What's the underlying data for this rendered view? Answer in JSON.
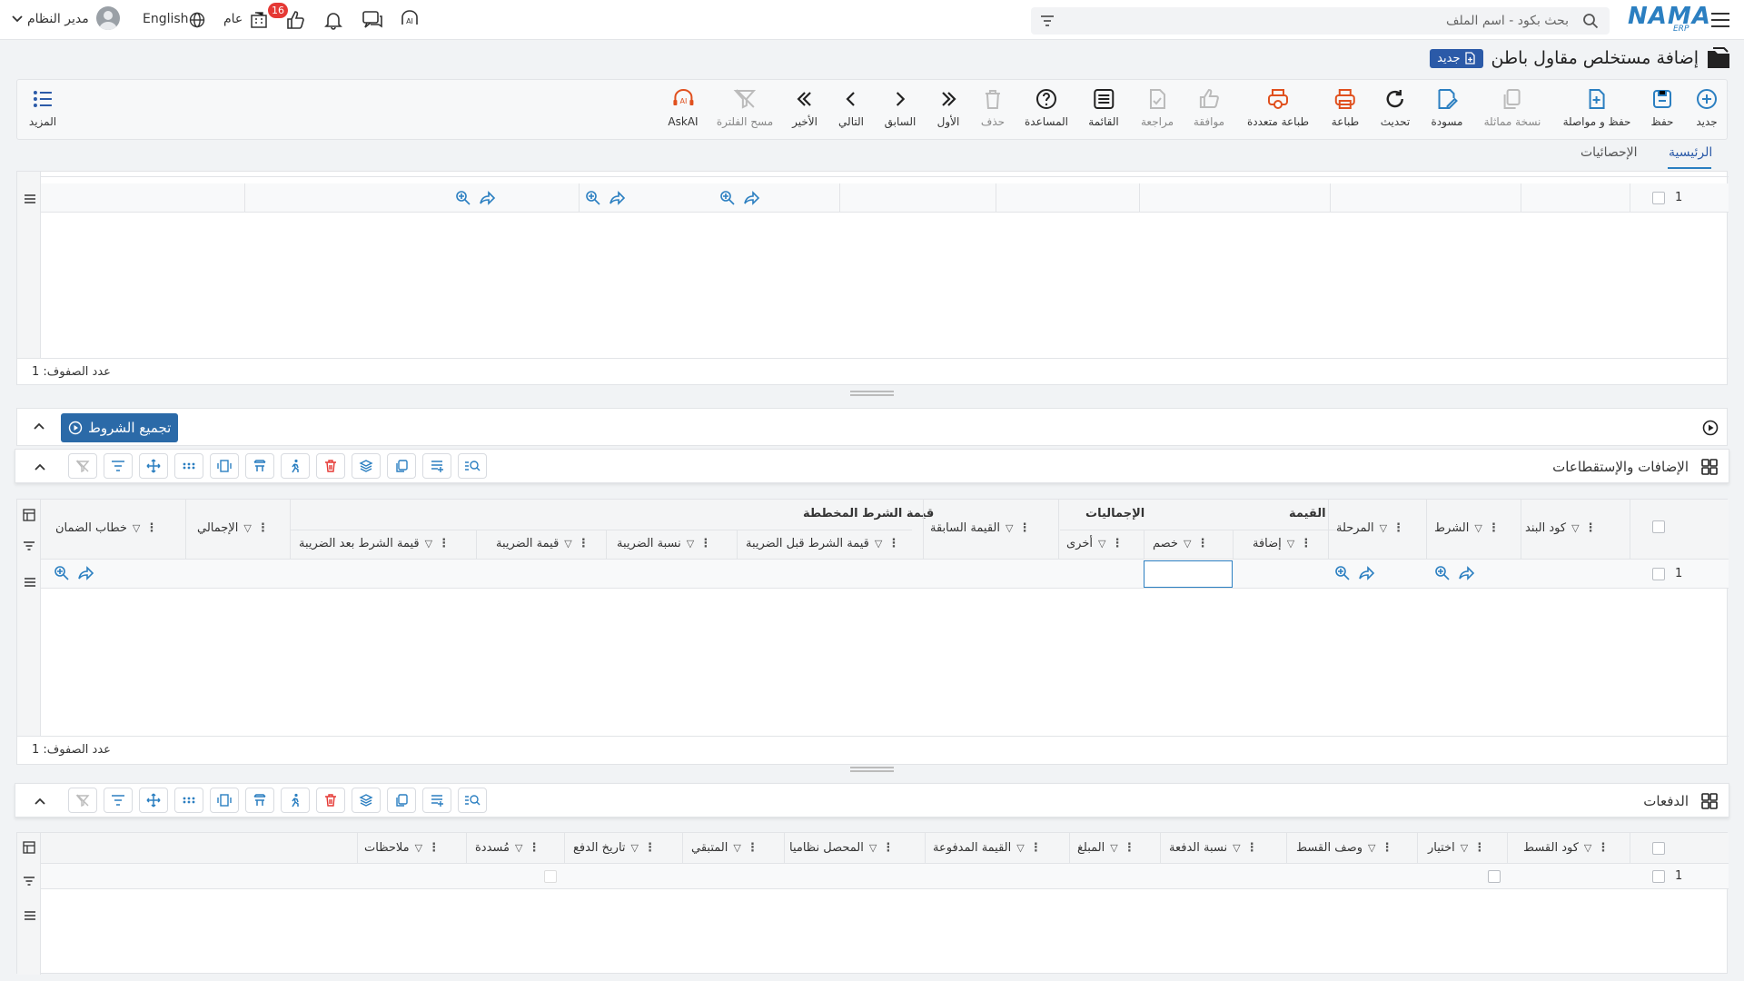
{
  "topbar": {
    "logo_text": "NAMA",
    "logo_sub": "ERP",
    "search_placeholder": "بحث بكود - اسم الملف",
    "user_name": "مدير النظام",
    "language": "English",
    "scope": "عام",
    "notifications_badge": "16"
  },
  "title": {
    "text": "إضافة مستخلص مقاول باطن",
    "badge": "جديد"
  },
  "toolbar": {
    "items": [
      {
        "label": "جديد",
        "icon": "plus-circle-icon"
      },
      {
        "label": "حفظ",
        "icon": "save-icon"
      },
      {
        "label": "حفظ و مواصلة",
        "icon": "file-plus-icon"
      },
      {
        "label": "نسخة مماثلة",
        "icon": "copy-icon"
      },
      {
        "label": "مسودة",
        "icon": "draft-icon"
      },
      {
        "label": "تحديث",
        "icon": "refresh-icon"
      },
      {
        "label": "طباعة",
        "icon": "print-icon"
      },
      {
        "label": "طباعة متعددة",
        "icon": "multi-print-icon"
      },
      {
        "label": "موافقة",
        "icon": "thumbs-up-icon"
      },
      {
        "label": "مراجعة",
        "icon": "review-icon"
      },
      {
        "label": "القائمة",
        "icon": "list-icon"
      },
      {
        "label": "المساعدة",
        "icon": "help-icon"
      },
      {
        "label": "حذف",
        "icon": "trash-icon"
      },
      {
        "label": "الأول",
        "icon": "first-icon"
      },
      {
        "label": "السابق",
        "icon": "prev-icon"
      },
      {
        "label": "التالي",
        "icon": "next-icon"
      },
      {
        "label": "الأخير",
        "icon": "last-icon"
      },
      {
        "label": "مسح الفلترة",
        "icon": "clear-filter-icon"
      },
      {
        "label": "AskAI",
        "icon": "ai-icon"
      }
    ],
    "more_label": "المزيد"
  },
  "tabs": {
    "main": "الرئيسية",
    "stats": "الإحصائيات"
  },
  "grid1": {
    "row_number": "1",
    "row_count_label": "عدد الصفوف: 1"
  },
  "collect_terms": {
    "label": "تجميع الشروط"
  },
  "additions": {
    "title": "الإضافات والإستقطاعات",
    "group_headers": {
      "value": "القيمة",
      "totals": "الإجماليات",
      "planned_term_value": "قيمة الشرط المخططة"
    },
    "columns": {
      "item_code": "كود البند",
      "term": "الشرط",
      "stage": "المرحلة",
      "addition": "إضافة",
      "discount": "خصم",
      "other": "أخرى",
      "previous_value": "القيمة السابقة",
      "value_before_tax": "قيمة الشرط قبل الضريبة",
      "tax_rate": "نسبة الضريبة",
      "tax_value": "قيمة الضريبة",
      "value_after_tax": "قيمة الشرط بعد الضريبة",
      "total": "الإجمالي",
      "guarantee_letter": "خطاب الضمان"
    },
    "row_number": "1",
    "row_count_label": "عدد الصفوف: 1"
  },
  "payments": {
    "title": "الدفعات",
    "columns": {
      "installment_code": "كود القسط",
      "select": "اختيار",
      "installment_desc": "وصف القسط",
      "payment_rate": "نسبة الدفعة",
      "amount": "المبلغ",
      "paid_value": "القيمة المدفوعة",
      "collected_system": "المحصل نظاميا",
      "remaining": "المتبقي",
      "payment_date": "تاريخ الدفع",
      "paid": "مُسددة",
      "notes": "ملاحظات"
    },
    "row_number": "1"
  },
  "colors": {
    "accent": "#2b5aa8",
    "link_blue": "#2b7fc1",
    "print_orange": "#e0501e",
    "badge_red": "#e53935"
  }
}
